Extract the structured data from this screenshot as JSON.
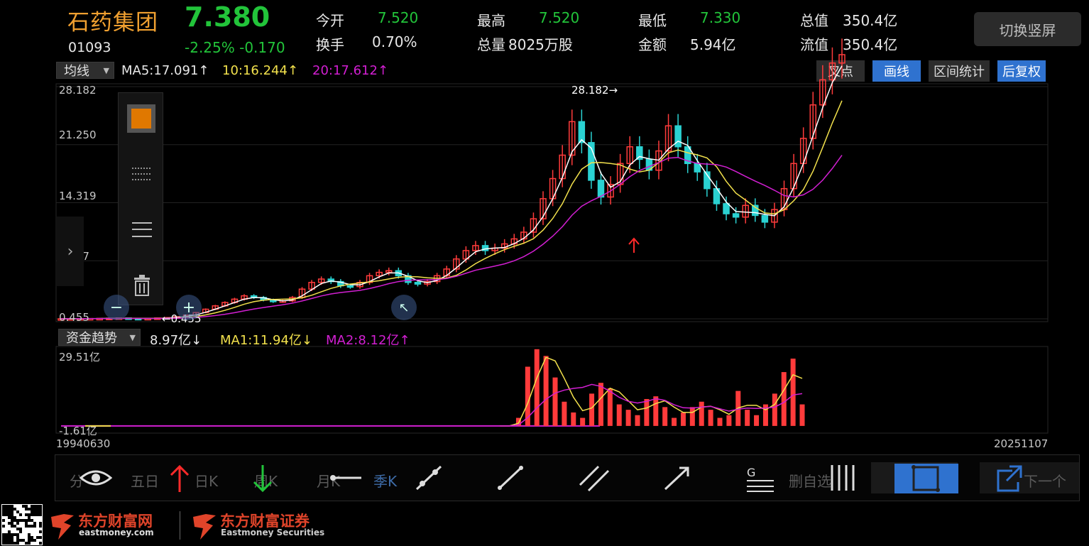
{
  "quote": {
    "name": "石药集团",
    "price": "7.380",
    "code": "01093",
    "change": "-2.25% -0.170",
    "fields": [
      {
        "label": "今开",
        "value": "7.520",
        "color": "green"
      },
      {
        "label": "最高",
        "value": "7.520",
        "color": "green"
      },
      {
        "label": "最低",
        "value": "7.330",
        "color": "green"
      },
      {
        "label": "总值",
        "value": "350.4亿",
        "color": "white"
      },
      {
        "label": "换手",
        "value": "0.70%",
        "color": "white"
      },
      {
        "label": "总量",
        "value": "8025万股",
        "color": "white"
      },
      {
        "label": "金额",
        "value": "5.94亿",
        "color": "white"
      },
      {
        "label": "流值",
        "value": "350.4亿",
        "color": "white"
      }
    ]
  },
  "rotate_button": "切换竖屏",
  "main_indicator": {
    "selector": "均线",
    "ma5": "MA5:17.091↑",
    "ma10": "10:16.244↑",
    "ma20": "20:17.612↑"
  },
  "toolbar": {
    "dot_label": "叉点",
    "draw": "画线",
    "interval": "区间统计",
    "adjust": "后复权"
  },
  "price_axis": [
    "28.182",
    "21.250",
    "14.319",
    "7.387",
    "0.455"
  ],
  "annotations": {
    "high": "28.182→",
    "low": "←0.455"
  },
  "sub_indicator": {
    "selector": "资金趋势",
    "value": "8.97亿↓",
    "ma1": "MA1:11.94亿↓",
    "ma2": "MA2:8.12亿↑",
    "axis_top": "29.51亿",
    "axis_bottom": "-1.61亿"
  },
  "date_axis": {
    "start": "19940630",
    "end": "20251107"
  },
  "period_tabs": [
    "分",
    "五日",
    "日K",
    "周K",
    "月K",
    "季K"
  ],
  "drawing_tools": {
    "delete": "删自选",
    "next": "下一个"
  },
  "footer": {
    "brand1": "东方财富网",
    "brand1_sub": "eastmoney.com",
    "brand2": "东方财富证券",
    "brand2_sub": "Eastmoney Securities"
  },
  "colors": {
    "up": "#ff3b3b",
    "down": "#2ad2d2",
    "ma5": "#ffffff",
    "ma10": "#f2e14c",
    "ma20": "#d21fd2",
    "accent": "#2f72cf",
    "name": "#f0a030"
  },
  "chart_data": {
    "type": "candlestick",
    "price_range": [
      0.455,
      28.182
    ],
    "ticks": [
      0.455,
      7.387,
      14.319,
      21.25,
      28.182
    ],
    "closes": [
      0.46,
      0.47,
      0.48,
      0.49,
      0.5,
      0.52,
      0.55,
      0.5,
      0.48,
      0.5,
      0.55,
      0.6,
      0.7,
      0.9,
      1.2,
      1.6,
      2.0,
      2.4,
      2.8,
      3.2,
      3.0,
      2.7,
      2.5,
      2.6,
      3.0,
      4.0,
      4.8,
      5.2,
      4.9,
      4.4,
      4.3,
      4.8,
      5.6,
      6.0,
      6.2,
      5.6,
      4.8,
      4.6,
      4.9,
      5.6,
      6.4,
      7.6,
      8.6,
      9.2,
      8.6,
      8.9,
      9.4,
      10.0,
      10.8,
      12.4,
      14.8,
      17.2,
      20.0,
      24.0,
      21.5,
      17.0,
      15.0,
      16.5,
      19.0,
      21.0,
      19.5,
      18.2,
      20.5,
      23.5,
      21.0,
      19.0,
      18.0,
      16.0,
      14.2,
      13.0,
      12.6,
      14.0,
      12.8,
      12.0,
      13.5,
      16.0,
      19.0,
      22.0,
      26.0,
      29.0,
      31.0,
      32.0
    ],
    "fund_flow_range": [
      -1.61,
      29.51
    ],
    "fund_flow": [
      0,
      0,
      0,
      0,
      0,
      0,
      0,
      0,
      0,
      0,
      0,
      0,
      0,
      0,
      0,
      0,
      0,
      0,
      0,
      0,
      0,
      0,
      0,
      0,
      0,
      0,
      0,
      0,
      0,
      0,
      0,
      0,
      0,
      0,
      0,
      0,
      0,
      0,
      0,
      0,
      0,
      0,
      0,
      0,
      0,
      0,
      0,
      0,
      0,
      0,
      3,
      22,
      28.5,
      26,
      18,
      9,
      5,
      3,
      12,
      16,
      14,
      8,
      6,
      4,
      10,
      11,
      7,
      3,
      5,
      7,
      9,
      6,
      3,
      4,
      13,
      6,
      4,
      8,
      12,
      20,
      25,
      8
    ]
  }
}
